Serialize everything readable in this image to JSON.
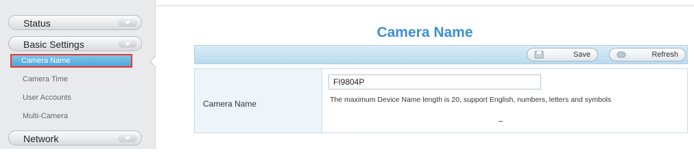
{
  "sidebar": {
    "status_label": "Status",
    "basic_settings_label": "Basic Settings",
    "network_label": "Network",
    "items": [
      {
        "label": "Camera Name"
      },
      {
        "label": "Camera Time"
      },
      {
        "label": "User Accounts"
      },
      {
        "label": "Multi-Camera"
      }
    ]
  },
  "main": {
    "title": "Camera Name",
    "toolbar": {
      "save_label": "Save",
      "refresh_label": "Refresh"
    },
    "form": {
      "label": "Camera Name",
      "input_value": "FI9804P",
      "hint": "The maximum Device Name length is 20, support English, numbers, letters and symbols"
    }
  },
  "colors": {
    "accent": "#3d8fd0",
    "active_item": "#4fa6d8",
    "highlight_border": "#e53935"
  }
}
